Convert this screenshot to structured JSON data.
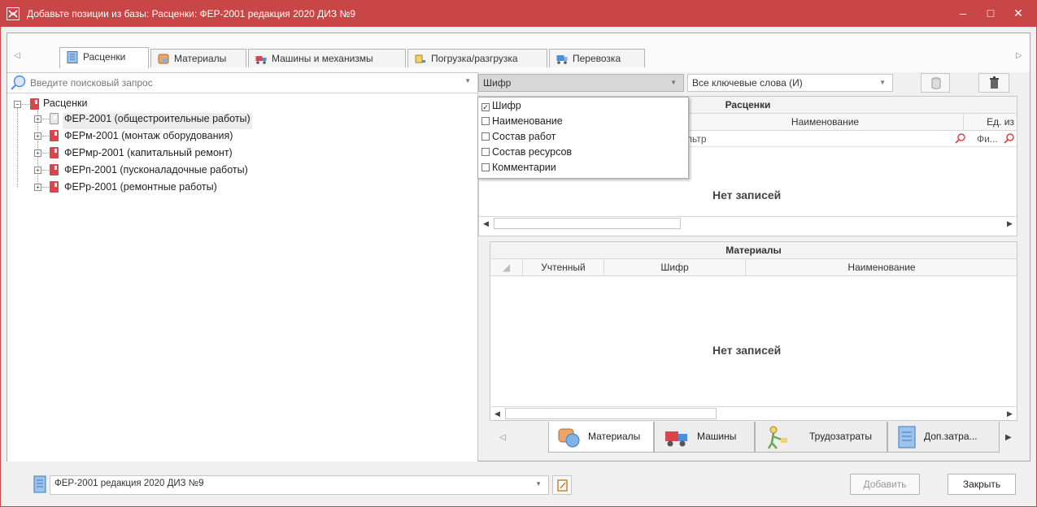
{
  "window": {
    "title": "Добавьте позиции из базы: Расценки: ФЕР-2001 редакция 2020 ДИЗ №9",
    "minimize": "–",
    "maximize": "□",
    "close": "✕"
  },
  "top_tabs": [
    {
      "label": "Расценки",
      "active": true
    },
    {
      "label": "Материалы",
      "active": false
    },
    {
      "label": "Машины и механизмы",
      "active": false
    },
    {
      "label": "Погрузка/разгрузка",
      "active": false
    },
    {
      "label": "Перевозка",
      "active": false
    }
  ],
  "search": {
    "placeholder": "Введите поисковый запрос"
  },
  "field_combo": {
    "value": "Шифр"
  },
  "keywords_combo": {
    "value": "Все ключевые слова (И)"
  },
  "field_options": [
    {
      "label": "Шифр",
      "checked": true
    },
    {
      "label": "Наименование",
      "checked": false
    },
    {
      "label": "Состав работ",
      "checked": false
    },
    {
      "label": "Состав ресурсов",
      "checked": false
    },
    {
      "label": "Комментарии",
      "checked": false
    }
  ],
  "tree": {
    "root": "Расценки",
    "children": [
      "ФЕР-2001 (общестроительные работы)",
      "ФЕРм-2001 (монтаж оборудования)",
      "ФЕРмр-2001 (капитальный ремонт)",
      "ФЕРп-2001 (пусконаладочные работы)",
      "ФЕРр-2001 (ремонтные работы)"
    ]
  },
  "rates_grid": {
    "title": "Расценки",
    "col_name": "Наименование",
    "col_unit": "Ед. из",
    "filter_text": "льтр",
    "filter_right": "Фи...",
    "empty": "Нет записей"
  },
  "materials_grid": {
    "title": "Материалы",
    "columns": [
      "Учтенный",
      "Шифр",
      "Наименование"
    ],
    "empty": "Нет записей"
  },
  "bottom_tabs": [
    {
      "label": "Материалы",
      "icon": "materials-icon",
      "active": true
    },
    {
      "label": "Машины",
      "icon": "truck-icon",
      "active": false
    },
    {
      "label": "Трудозатраты",
      "icon": "worker-icon",
      "active": false
    },
    {
      "label": "Доп.затра...",
      "icon": "document-icon",
      "active": false
    }
  ],
  "footer": {
    "base_value": "ФЕР-2001 редакция 2020 ДИЗ №9",
    "add_label": "Добавить",
    "close_label": "Закрыть"
  },
  "colors": {
    "titlebar": "#c94646",
    "book_red": "#d9454a",
    "accent_blue": "#4a90d9"
  }
}
